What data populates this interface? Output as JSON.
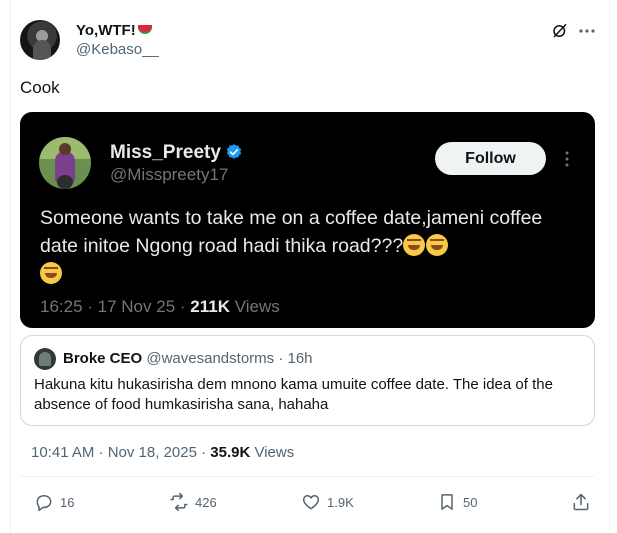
{
  "author": {
    "display_name": "Yo,WTF!",
    "handle": "@Kebaso__",
    "avatar_icon": "avatar",
    "name_emoji": "watermelon"
  },
  "header_icons": [
    "grok-icon",
    "more-icon"
  ],
  "post": {
    "text": "Cook",
    "timestamp": "10:41 AM · Nov 18, 2025 · ",
    "views_count": "35.9K",
    "views_label": " Views"
  },
  "embedded_screenshot": {
    "name": "Miss_Preety",
    "handle": "@Misspreety17",
    "verified": true,
    "follow_label": "Follow",
    "text": "Someone wants to take me on a coffee date,jameni coffee date initoe Ngong road hadi thika road???",
    "meta_time": "16:25 · 17 Nov 25 · ",
    "meta_views_count": "211K",
    "meta_views_label": " Views",
    "emoji": "rolling-on-floor-laughing"
  },
  "quoted": {
    "name": "Broke CEO",
    "handle": "@wavesandstorms",
    "age": " · 16h",
    "text": "Hakuna kitu hukasirisha dem mnono kama umuite coffee date. The idea of the absence of food humkasirisha sana, hahaha"
  },
  "actions": {
    "reply_count": "16",
    "retweet_count": "426",
    "like_count": "1.9K",
    "bookmark_count": "50"
  },
  "colors": {
    "text": "#0f1419",
    "secondary": "#536471",
    "verified": "#1d9bf0",
    "dark_bg": "#000000"
  }
}
